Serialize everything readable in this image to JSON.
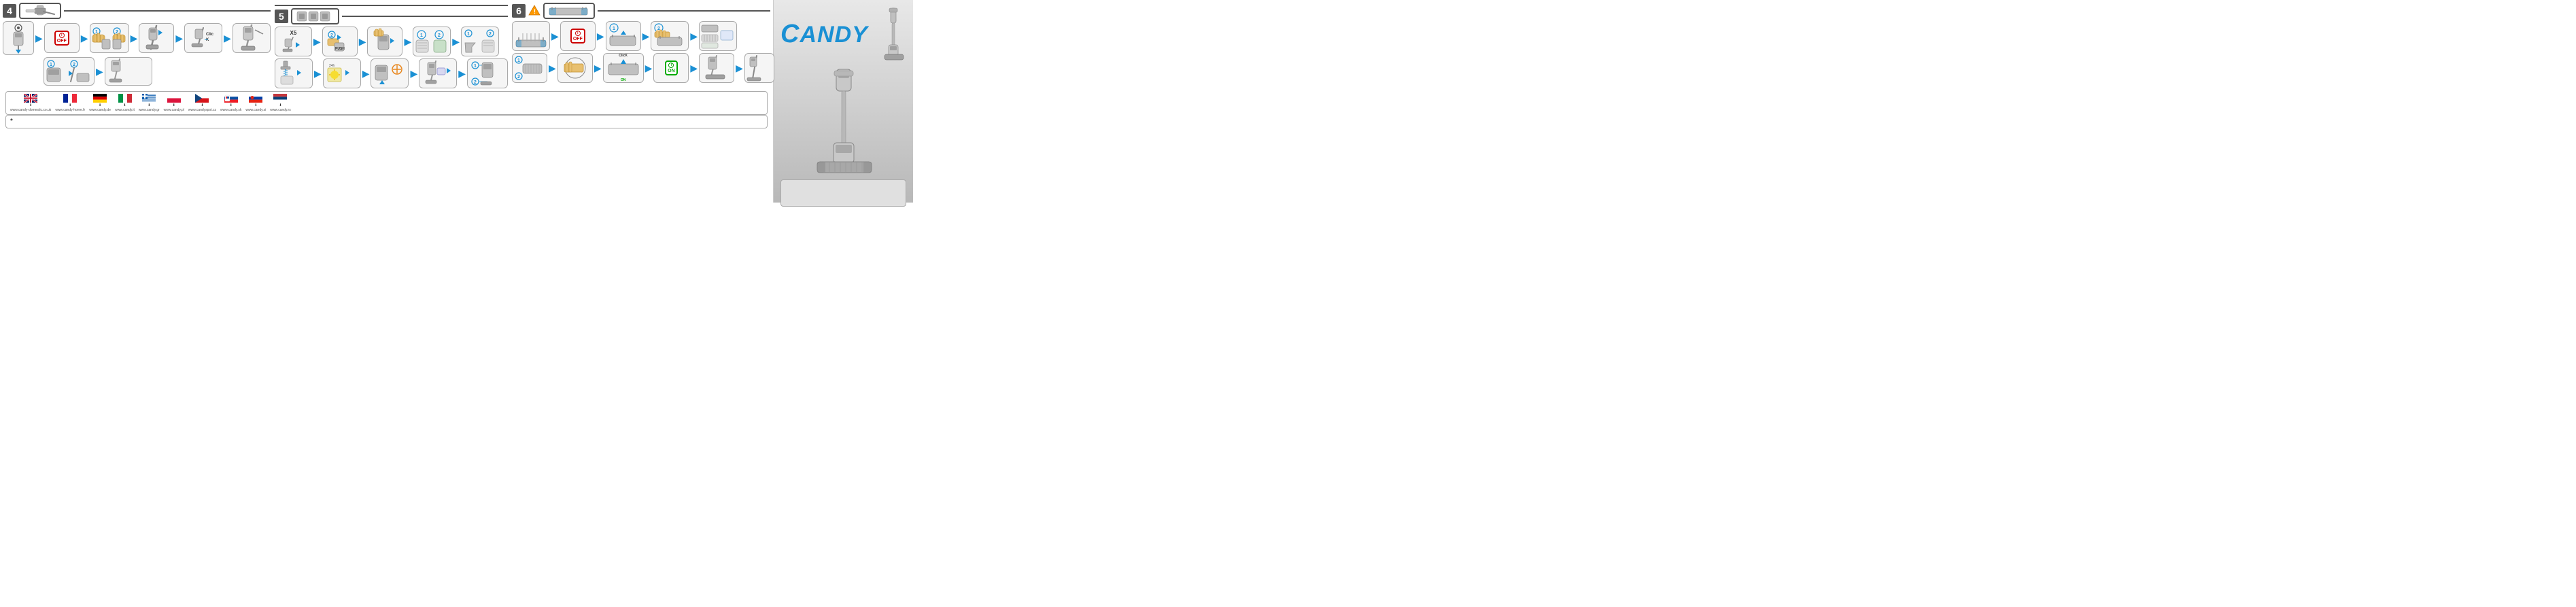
{
  "sections": {
    "section4": {
      "number": "4",
      "header_label": "4",
      "steps_row1": [
        {
          "id": "4-main",
          "type": "vacuum-down",
          "desc": "main vacuum unit with arrow down"
        },
        {
          "arrow": true
        },
        {
          "id": "4-1",
          "type": "off-badge-step",
          "desc": "OFF badge with vacuum"
        },
        {
          "arrow": true
        },
        {
          "id": "4-2a",
          "type": "hand-press-1",
          "desc": "hand pressing step 1"
        },
        {
          "id": "4-2b",
          "type": "hand-press-2",
          "desc": "hand pressing step 2"
        },
        {
          "arrow": true
        },
        {
          "id": "4-3",
          "type": "vacuum-stand",
          "desc": "vacuum standing"
        },
        {
          "arrow": true
        },
        {
          "id": "4-4",
          "type": "vacuum-click",
          "desc": "vacuum with CLICK label"
        },
        {
          "arrow": true
        },
        {
          "id": "4-5",
          "type": "vacuum-assembled",
          "desc": "assembled vacuum"
        }
      ],
      "steps_row2": [
        {
          "id": "4-r2-1",
          "type": "parts-1-2",
          "desc": "parts numbered 1 and 2"
        },
        {
          "arrow": true
        },
        {
          "id": "4-r2-2",
          "type": "vacuum-slim",
          "desc": "slim vacuum assembled"
        }
      ]
    },
    "section5": {
      "number": "5",
      "header_label": "5",
      "steps_row1": [
        {
          "id": "5-x5",
          "type": "x5-repeat",
          "desc": "X5 repeat label with tap icon"
        },
        {
          "arrow": true
        },
        {
          "id": "5-1",
          "type": "push-step",
          "desc": "push step"
        },
        {
          "arrow": true
        },
        {
          "id": "5-2",
          "type": "hand-grip",
          "desc": "hand grip step"
        },
        {
          "arrow": true
        },
        {
          "id": "5-3",
          "type": "vacuum-filter",
          "desc": "vacuum filter"
        },
        {
          "arrow": true
        },
        {
          "id": "5-4",
          "type": "vacuum-parts",
          "desc": "vacuum parts 1 2"
        }
      ],
      "steps_row2": [
        {
          "id": "5-r2-1",
          "type": "faucet-wash",
          "desc": "faucet washing"
        },
        {
          "arrow": true
        },
        {
          "id": "5-r2-2",
          "type": "dry-step",
          "desc": "drying step"
        },
        {
          "arrow": true
        },
        {
          "id": "5-r2-3",
          "type": "reassemble-1",
          "desc": "reassemble step 1"
        },
        {
          "arrow": true
        },
        {
          "id": "5-r2-4",
          "type": "reassemble-2",
          "desc": "reassemble step 2"
        },
        {
          "arrow": true
        },
        {
          "id": "5-r2-5",
          "type": "reassemble-3",
          "desc": "reassemble step 3"
        }
      ]
    },
    "section6": {
      "number": "6",
      "header_label": "6",
      "warning": true,
      "steps_row1": [
        {
          "id": "6-1",
          "type": "floor-brush",
          "desc": "floor brush attachment"
        },
        {
          "arrow": true
        },
        {
          "id": "6-2",
          "type": "off-badge-floor",
          "desc": "OFF badge with floor brush"
        },
        {
          "arrow": true
        },
        {
          "id": "6-3",
          "type": "brush-remove",
          "desc": "brush removal step"
        },
        {
          "arrow": true
        },
        {
          "id": "6-4",
          "type": "brush-hand",
          "desc": "hand holding brush part"
        },
        {
          "arrow": true
        },
        {
          "id": "6-5",
          "type": "brush-parts",
          "desc": "brush parts laid out"
        }
      ],
      "steps_row2": [
        {
          "id": "6-r2-1",
          "type": "brush-clean-1",
          "desc": "clean brush step 1"
        },
        {
          "arrow": true
        },
        {
          "id": "6-r2-2",
          "type": "brush-clean-2",
          "desc": "clean brush step 2"
        },
        {
          "arrow": true
        },
        {
          "id": "6-r2-3",
          "type": "brush-click-on",
          "desc": "brush with CLICK ON label"
        },
        {
          "arrow": true
        },
        {
          "id": "6-r2-4",
          "type": "on-badge-step",
          "desc": "ON badge step"
        },
        {
          "arrow": true
        },
        {
          "id": "6-r2-5",
          "type": "brush-done",
          "desc": "brush reassembled"
        },
        {
          "arrow": true
        },
        {
          "id": "6-r2-6",
          "type": "brush-final",
          "desc": "final brush step"
        }
      ]
    }
  },
  "links": {
    "flags": [
      {
        "country": "GB",
        "url": "www.candy-domestic.co.uk",
        "download": true
      },
      {
        "country": "FR",
        "url": "www.candy-home.fr",
        "download": true
      },
      {
        "country": "DE",
        "url": "www.candy.de",
        "download": true
      },
      {
        "country": "IT",
        "url": "www.candy.it",
        "download": true
      },
      {
        "country": "GR",
        "url": "www.candy.gr",
        "download": true
      },
      {
        "country": "PL",
        "url": "www.candy.pl",
        "download": true
      },
      {
        "country": "CZ",
        "url": "www.candyspot.cz",
        "download": true
      },
      {
        "country": "SK",
        "url": "www.candy.sk",
        "download": true
      },
      {
        "country": "SI",
        "url": "www.candy.si",
        "download": true
      },
      {
        "country": "RS",
        "url": "www.candy.rs",
        "download": true
      }
    ],
    "footnote": "*"
  },
  "brand": {
    "name": "CANDY",
    "logo_text": "CANDY"
  },
  "labels": {
    "off": "OFF",
    "on": "ON",
    "click": "ClicK",
    "click_on": "ClicK\nOn",
    "push": "PUSH",
    "x5": "X5"
  }
}
